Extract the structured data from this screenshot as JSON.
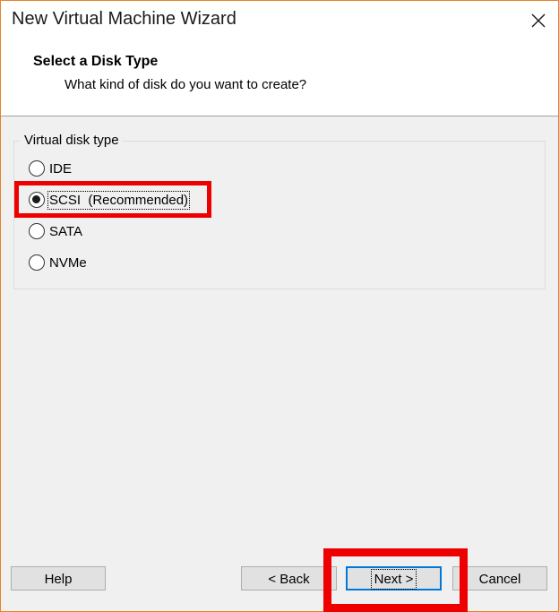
{
  "window": {
    "title": "New Virtual Machine Wizard",
    "close_glyph": "✕"
  },
  "header": {
    "title": "Select a Disk Type",
    "subtitle": "What kind of disk do you want to create?"
  },
  "disk_type_group": {
    "label": "Virtual disk type",
    "selected": "SCSI",
    "options": [
      {
        "value": "IDE",
        "label": "IDE",
        "checked": false
      },
      {
        "value": "SCSI",
        "label": "SCSI  (Recommended)",
        "checked": true
      },
      {
        "value": "SATA",
        "label": "SATA",
        "checked": false
      },
      {
        "value": "NVMe",
        "label": "NVMe",
        "checked": false
      }
    ]
  },
  "buttons": {
    "help": "Help",
    "back": "< Back",
    "next": "Next >",
    "cancel": "Cancel"
  },
  "colors": {
    "highlight": "#ee0000",
    "window_border": "#e8822a",
    "default_button_border": "#0078d7"
  }
}
